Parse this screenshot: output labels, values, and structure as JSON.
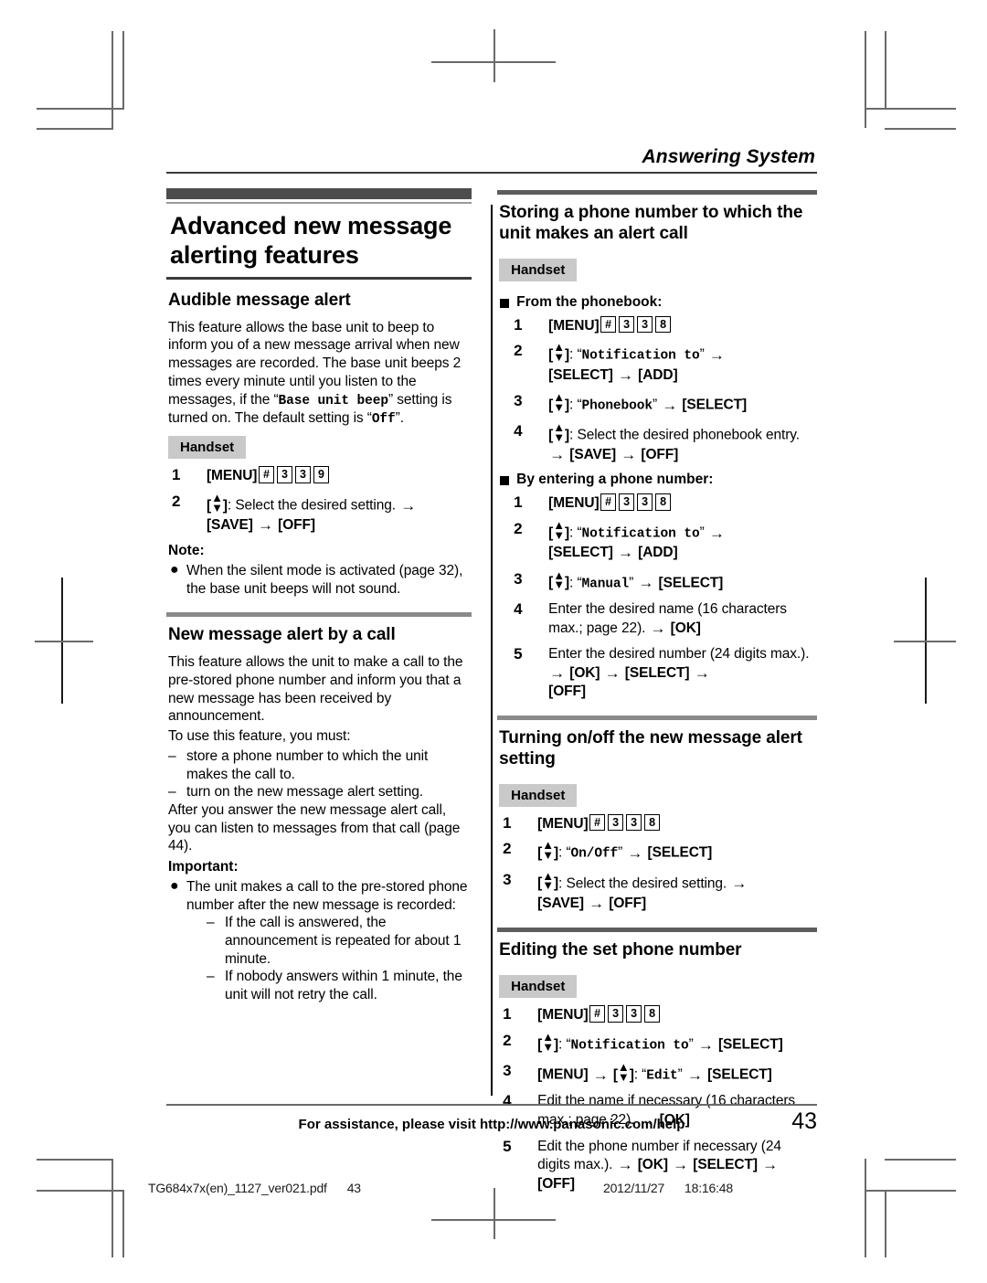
{
  "running_head": "Answering System",
  "chapter_title": "Advanced new message alerting features",
  "left": {
    "section1": {
      "title": "Audible message alert",
      "paragraph_a": "This feature allows the base unit to beep to inform you of a new message arrival when new messages are recorded. The base unit beeps 2 times every minute until you listen to the messages, if the ",
      "mono_base_unit_beep": "Base unit beep",
      "paragraph_b": " setting is turned on. The default setting is ",
      "mono_off": "Off",
      "paragraph_c": ".",
      "handset": "Handset",
      "step1_prefix": "[MENU]",
      "step1_keys": [
        "#",
        "3",
        "3",
        "9"
      ],
      "step2": ": Select the desired setting. ",
      "step2_save": "[SAVE]",
      "step2_off": "[OFF]",
      "note_label": "Note:",
      "note_item": "When the silent mode is activated (page 32), the base unit beeps will not sound."
    },
    "section2": {
      "title": "New message alert by a call",
      "paragraph_a": "This feature allows the unit to make a call to the pre-stored phone number and inform you that a new message has been received by announcement.",
      "paragraph_b": "To use this feature, you must:",
      "dash_items": [
        "store a phone number to which the unit makes the call to.",
        "turn on the new message alert setting."
      ],
      "paragraph_c": "After you answer the new message alert call, you can listen to messages from that call (page 44).",
      "important_label": "Important:",
      "important_item": "The unit makes a call to the pre-stored phone number after the new message is recorded:",
      "important_sub": [
        "If the call is answered, the announcement is repeated for about 1 minute.",
        "If nobody answers within 1 minute, the unit will not retry the call."
      ]
    }
  },
  "right": {
    "section1": {
      "title": "Storing a phone number to which the unit makes an alert call",
      "handset": "Handset",
      "sub1_title": "From the phonebook:",
      "sub1_steps": [
        {
          "num": "1",
          "menu": "[MENU]",
          "keys": [
            "#",
            "3",
            "3",
            "8"
          ]
        },
        {
          "num": "2",
          "quoted": "Notification to",
          "tail_bold": [
            "[SELECT]",
            "[ADD]"
          ]
        },
        {
          "num": "3",
          "quoted": "Phonebook",
          "tail_bold": [
            "[SELECT]"
          ]
        },
        {
          "num": "4",
          "plain": ": Select the desired phonebook entry. ",
          "tail_bold": [
            "[SAVE]",
            "[OFF]"
          ]
        }
      ],
      "sub2_title": "By entering a phone number:",
      "sub2_steps": [
        {
          "num": "1",
          "menu": "[MENU]",
          "keys": [
            "#",
            "3",
            "3",
            "8"
          ]
        },
        {
          "num": "2",
          "quoted": "Notification to",
          "tail_bold": [
            "[SELECT]",
            "[ADD]"
          ]
        },
        {
          "num": "3",
          "quoted": "Manual",
          "tail_bold": [
            "[SELECT]"
          ]
        },
        {
          "num": "4",
          "text": "Enter the desired name (16 characters max.; page 22). ",
          "tail_bold": [
            "[OK]"
          ]
        },
        {
          "num": "5",
          "text": "Enter the desired number (24 digits max.). ",
          "tail_bold": [
            "[OK]",
            "[SELECT]",
            "[OFF]"
          ]
        }
      ]
    },
    "section2": {
      "title": "Turning on/off the new message alert setting",
      "handset": "Handset",
      "steps": [
        {
          "num": "1",
          "menu": "[MENU]",
          "keys": [
            "#",
            "3",
            "3",
            "8"
          ]
        },
        {
          "num": "2",
          "quoted": "On/Off",
          "tail_bold": [
            "[SELECT]"
          ]
        },
        {
          "num": "3",
          "plain": ": Select the desired setting. ",
          "tail_bold": [
            "[SAVE]",
            "[OFF]"
          ]
        }
      ]
    },
    "section3": {
      "title": "Editing the set phone number",
      "handset": "Handset",
      "steps": [
        {
          "num": "1",
          "menu": "[MENU]",
          "keys": [
            "#",
            "3",
            "3",
            "8"
          ]
        },
        {
          "num": "2",
          "quoted": "Notification to",
          "tail_bold": [
            "[SELECT]"
          ]
        },
        {
          "num": "3",
          "menu_lead": "[MENU]",
          "quoted": "Edit",
          "tail_bold": [
            "[SELECT]"
          ]
        },
        {
          "num": "4",
          "text": "Edit the name if necessary (16 characters max.; page 22). ",
          "tail_bold": [
            "[OK]"
          ]
        },
        {
          "num": "5",
          "text": "Edit the phone number if necessary (24 digits max.). ",
          "tail_bold": [
            "[OK]",
            "[SELECT]",
            "[OFF]"
          ]
        }
      ]
    }
  },
  "footer": {
    "text": "For assistance, please visit http://www.panasonic.com/help",
    "page": "43"
  },
  "slug": {
    "file": "TG684x7x(en)_1127_ver021.pdf",
    "page": "43",
    "date": "2012/11/27",
    "time": "18:16:48"
  }
}
